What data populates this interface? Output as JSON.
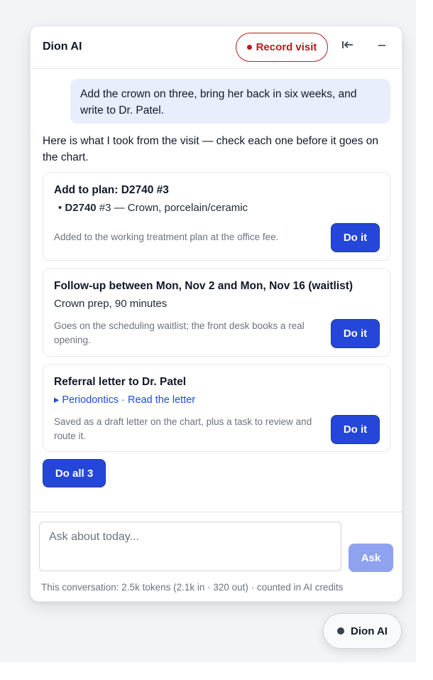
{
  "header": {
    "title": "Dion AI",
    "record_label": "Record visit",
    "collapse_icon": "collapse-left-icon",
    "minimize_icon": "minimize-icon"
  },
  "conversation": {
    "user_message": "Add the crown on three, bring her back in six weeks, and write to Dr. Patel.",
    "assistant_intro": "Here is what I took from the visit — check each one before it goes on the chart."
  },
  "cards": [
    {
      "title": "Add to plan: D2740 #3",
      "code": "D2740",
      "detail": " #3 — Crown, porcelain/ceramic",
      "note": "Added to the working treatment plan at the office fee.",
      "action": "Do it"
    },
    {
      "title": "Follow-up between Mon, Nov 2 and Mon, Nov 16 (waitlist)",
      "detail": "Crown prep, 90 minutes",
      "note": "Goes on the scheduling waitlist; the front desk books a real opening.",
      "action": "Do it"
    },
    {
      "title": "Referral letter to Dr. Patel",
      "link_specialty": "Periodontics",
      "link_separator": " · ",
      "link_read": "Read the letter",
      "note": "Saved as a draft letter on the chart, plus a task to review and route it.",
      "action": "Do it"
    }
  ],
  "do_all_label": "Do all 3",
  "composer": {
    "placeholder": "Ask about today...",
    "ask_label": "Ask",
    "token_note": "This conversation: 2.5k tokens (2.1k in · 320 out) · counted in AI credits"
  },
  "fab": {
    "label": "Dion AI"
  },
  "colors": {
    "accent": "#2447d9",
    "record": "#b91c1c",
    "user_bubble": "#e8eefc",
    "ask_disabled": "#8ea2f0"
  }
}
